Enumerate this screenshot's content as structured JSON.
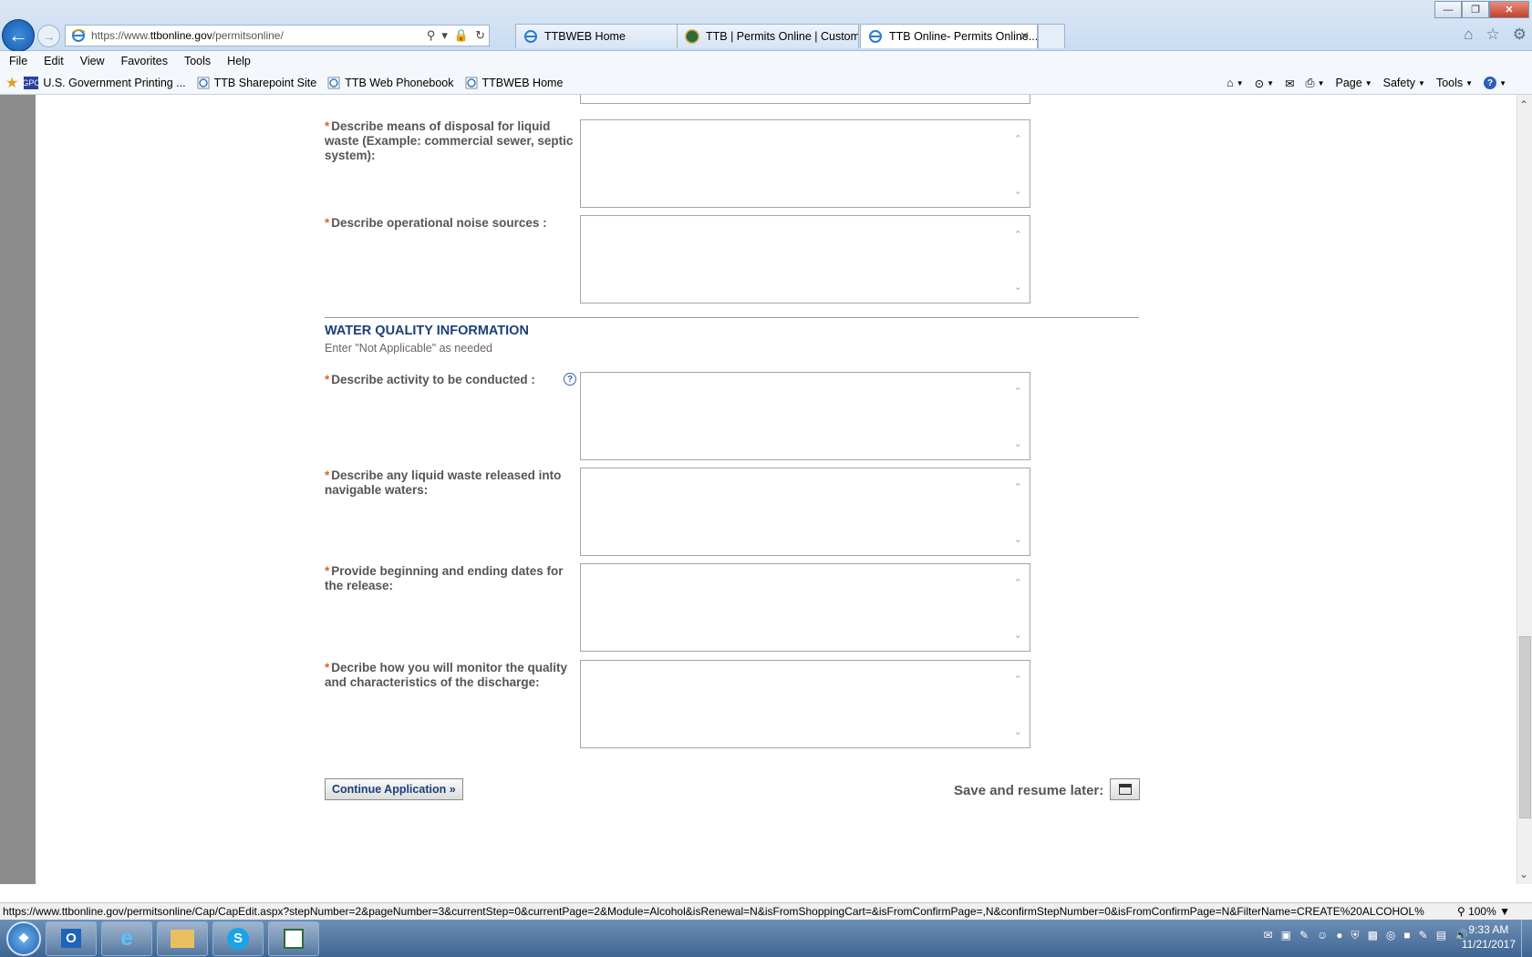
{
  "browser": {
    "address_scheme": "https://www.",
    "address_domain": "ttbonline.gov",
    "address_path": "/permitsonline/",
    "tabs": [
      {
        "label": "TTBWEB Home"
      },
      {
        "label": "TTB | Permits Online | Custom..."
      },
      {
        "label": "TTB Online- Permits Online..."
      }
    ],
    "menu": [
      "File",
      "Edit",
      "View",
      "Favorites",
      "Tools",
      "Help"
    ],
    "favorites": [
      {
        "label": "U.S. Government Printing ...",
        "icon": "gpo-icon"
      },
      {
        "label": "TTB Sharepoint Site",
        "icon": "ie-page-icon"
      },
      {
        "label": "TTB Web Phonebook",
        "icon": "ie-page-icon"
      },
      {
        "label": "TTBWEB Home",
        "icon": "ie-page-icon"
      }
    ],
    "commands": {
      "page": "Page",
      "safety": "Safety",
      "tools": "Tools"
    },
    "status_url": "https://www.ttbonline.gov/permitsonline/Cap/CapEdit.aspx?stepNumber=2&pageNumber=3&currentStep=0&currentPage=2&Module=Alcohol&isRenewal=N&isFromShoppingCart=&isFromConfirmPage=,N&confirmStepNumber=0&isFromConfirmPage=N&FilterName=CREATE%20ALCOHOL%",
    "zoom": "100%"
  },
  "form": {
    "required_mark": "*",
    "fields_top": [
      {
        "label": "Describe means of disposal for liquid waste (Example: commercial sewer, septic system):",
        "value": ""
      },
      {
        "label": "Describe operational noise sources :",
        "value": ""
      }
    ],
    "section": {
      "title": "WATER QUALITY INFORMATION",
      "subtitle": "Enter \"Not Applicable\" as needed"
    },
    "fields_water": [
      {
        "label": "Describe activity to be conducted :",
        "value": "",
        "help_icon": "?"
      },
      {
        "label": "Describe any liquid waste released into navigable waters:",
        "value": ""
      },
      {
        "label": "Provide beginning and ending dates for the release:",
        "value": ""
      },
      {
        "label": "Decribe how you will monitor the quality and characteristics of the discharge:",
        "value": ""
      }
    ],
    "continue_label": "Continue Application »",
    "save_label": "Save and resume later:"
  },
  "taskbar": {
    "apps": [
      "Outlook",
      "Internet Explorer",
      "File Explorer",
      "Skype",
      "Notes"
    ],
    "time": "9:33 AM",
    "date": "11/21/2017"
  },
  "colors": {
    "section_title": "#1b3f78",
    "required": "#e0661a",
    "label_gray": "#555555"
  }
}
